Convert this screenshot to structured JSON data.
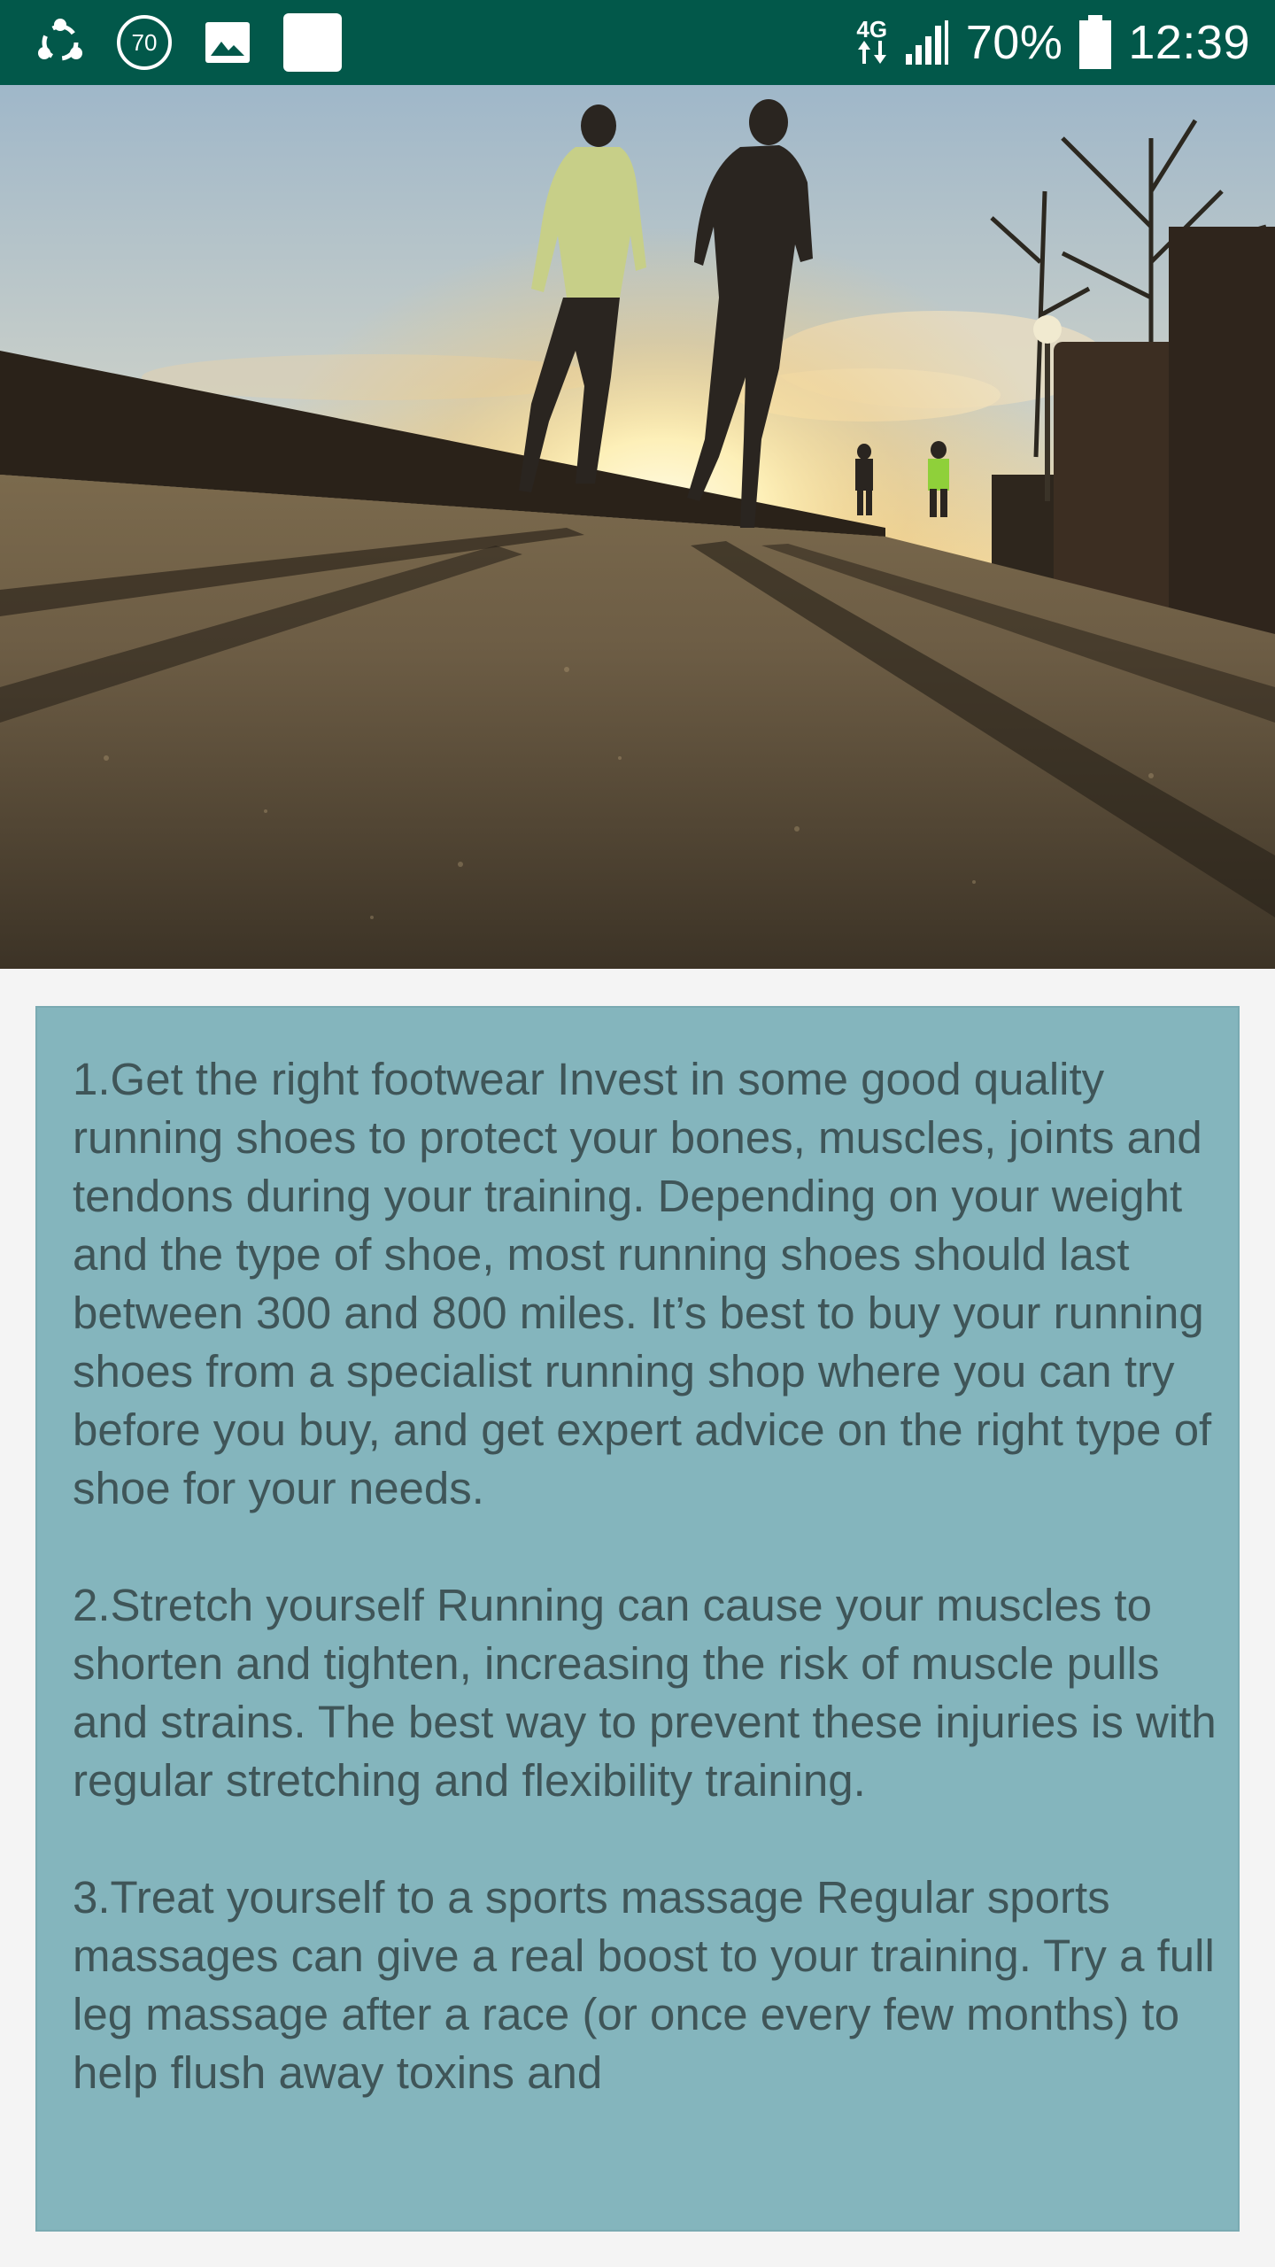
{
  "status_bar": {
    "left_icons": [
      "sync-icon",
      "notification-70-icon",
      "gallery-icon",
      "blank-app-icon"
    ],
    "badge_number": "70",
    "network_type": "4G",
    "battery_percent": "70%",
    "time": "12:39",
    "colors": {
      "background": "#02584a",
      "foreground": "#ffffff"
    }
  },
  "hero": {
    "subject": "runners-at-sunset-photo"
  },
  "tips": [
    "1.Get the right footwear Invest in some good quality running shoes to protect your bones, muscles, joints and tendons during your training. Depending on your weight and the type of shoe, most running shoes should last between 300 and 800 miles. It’s best to buy your running shoes from a specialist running shop where you can try before you buy, and get expert advice on the right type of shoe for your needs.",
    "2.Stretch yourself Running can cause your muscles to shorten and tighten, increasing the risk of muscle pulls and strains. The best way to prevent these injuries is with regular stretching and flexibility training.",
    "3.Treat yourself to a sports massage Regular sports massages can give a real boost to your training. Try a full leg massage after a race (or once every few months) to help flush away toxins and"
  ],
  "colors": {
    "card_background": "#84b5bd",
    "card_text": "#3f5558",
    "page_background": "#f4f4f4"
  }
}
